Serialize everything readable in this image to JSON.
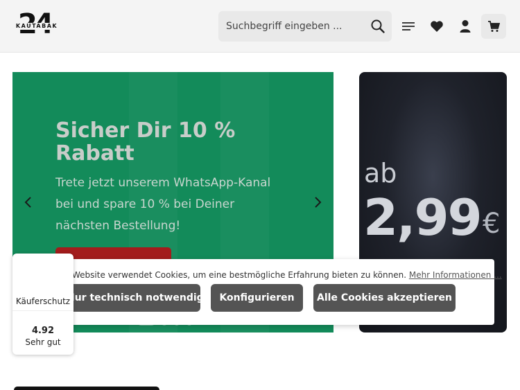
{
  "header": {
    "logo": {
      "number": "24",
      "word": "KAUTABAK",
      "icon": "brand-logo"
    },
    "search": {
      "placeholder": "Suchbegriff eingeben ...",
      "icon": "search-icon"
    },
    "icons": [
      "menu-icon",
      "heart-icon",
      "user-icon",
      "cart-icon"
    ]
  },
  "slider": {
    "headline": "Sicher Dir 10 % Rabatt",
    "subtext": "Trete jetzt unserem WhatsApp-Kanal bei und spare 10 % bei Deiner nächsten Bestellung!",
    "background": "#138b5a",
    "cta_color": "#a31c1c",
    "prev_icon": "chevron-left-icon",
    "next_icon": "chevron-right-icon"
  },
  "promo": {
    "prefix": "ab",
    "price": "2,99",
    "currency": "€"
  },
  "cookie": {
    "message": "Website verwendet Cookies, um eine bestmögliche Erfahrung bieten zu können.",
    "link": "Mehr Informationen ...",
    "button_technical": "Nur technisch notwendige",
    "button_configure": "Konfigurieren",
    "button_accept_all": "Alle Cookies akzeptieren",
    "button_color": "#545454"
  },
  "trust_badge": {
    "label": "Käuferschutz",
    "score": "4.92",
    "rating_text": "Sehr gut"
  }
}
